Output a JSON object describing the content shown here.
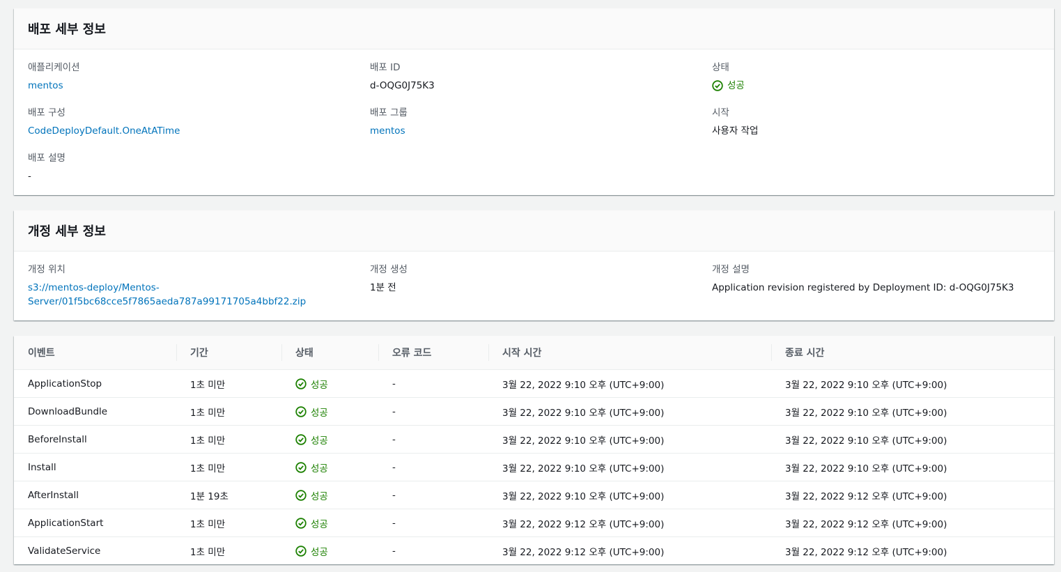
{
  "deployment": {
    "title": "배포 세부 정보",
    "application_label": "애플리케이션",
    "application_value": "mentos",
    "deployment_id_label": "배포 ID",
    "deployment_id_value": "d-OQG0J75K3",
    "status_label": "상태",
    "status_value": "성공",
    "config_label": "배포 구성",
    "config_value": "CodeDeployDefault.OneAtATime",
    "group_label": "배포 그룹",
    "group_value": "mentos",
    "initiated_label": "시작",
    "initiated_value": "사용자 작업",
    "description_label": "배포 설명",
    "description_value": "-"
  },
  "revision": {
    "title": "개정 세부 정보",
    "location_label": "개정 위치",
    "location_line1": "s3://mentos-deploy/Mentos-",
    "location_line2": "Server/01f5bc68cce5f7865aeda787a99171705a4bbf22.zip",
    "created_label": "개정 생성",
    "created_value": "1분 전",
    "description_label": "개정 설명",
    "description_value": "Application revision registered by Deployment ID: d-OQG0J75K3"
  },
  "events": {
    "columns": [
      "이벤트",
      "기간",
      "상태",
      "오류 코드",
      "시작 시간",
      "종료 시간"
    ],
    "rows": [
      {
        "event": "ApplicationStop",
        "duration": "1초 미만",
        "status": "성공",
        "error": "-",
        "start": "3월 22, 2022 9:10 오후 (UTC+9:00)",
        "end": "3월 22, 2022 9:10 오후 (UTC+9:00)"
      },
      {
        "event": "DownloadBundle",
        "duration": "1초 미만",
        "status": "성공",
        "error": "-",
        "start": "3월 22, 2022 9:10 오후 (UTC+9:00)",
        "end": "3월 22, 2022 9:10 오후 (UTC+9:00)"
      },
      {
        "event": "BeforeInstall",
        "duration": "1초 미만",
        "status": "성공",
        "error": "-",
        "start": "3월 22, 2022 9:10 오후 (UTC+9:00)",
        "end": "3월 22, 2022 9:10 오후 (UTC+9:00)"
      },
      {
        "event": "Install",
        "duration": "1초 미만",
        "status": "성공",
        "error": "-",
        "start": "3월 22, 2022 9:10 오후 (UTC+9:00)",
        "end": "3월 22, 2022 9:10 오후 (UTC+9:00)"
      },
      {
        "event": "AfterInstall",
        "duration": "1분 19초",
        "status": "성공",
        "error": "-",
        "start": "3월 22, 2022 9:10 오후 (UTC+9:00)",
        "end": "3월 22, 2022 9:12 오후 (UTC+9:00)"
      },
      {
        "event": "ApplicationStart",
        "duration": "1초 미만",
        "status": "성공",
        "error": "-",
        "start": "3월 22, 2022 9:12 오후 (UTC+9:00)",
        "end": "3월 22, 2022 9:12 오후 (UTC+9:00)"
      },
      {
        "event": "ValidateService",
        "duration": "1초 미만",
        "status": "성공",
        "error": "-",
        "start": "3월 22, 2022 9:12 오후 (UTC+9:00)",
        "end": "3월 22, 2022 9:12 오후 (UTC+9:00)"
      }
    ]
  },
  "colors": {
    "link": "#0073bb",
    "success": "#1d8102"
  }
}
